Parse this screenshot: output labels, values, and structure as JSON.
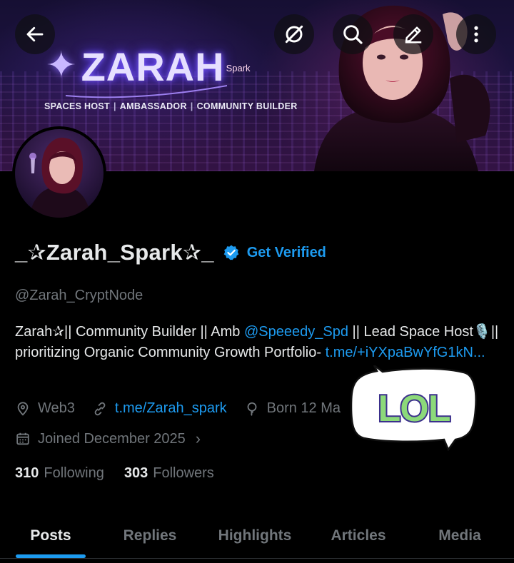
{
  "banner": {
    "brand_name": "ZARAH",
    "brand_sub": "Spark",
    "tagline": [
      "SPACES HOST",
      "AMBASSADOR",
      "COMMUNITY BUILDER"
    ]
  },
  "profile": {
    "display_name": "_✰Zarah_Spark✰_",
    "get_verified_label": "Get Verified",
    "handle": "@Zarah_CryptNode",
    "bio": {
      "part1": "Zarah✰|| Community Builder || Amb ",
      "mention": "@Speeedy_Spd",
      "part2": " ||  Lead Space Host",
      "mic": "🎙️",
      "part3": "|| prioritizing Organic Community Growth   Portfolio- ",
      "link": "t.me/​+iYXpaBwYfG1kN..."
    },
    "location": "Web3",
    "website": "t.me/Zarah_spark",
    "born": "Born 12 Ma",
    "joined": "Joined December 2025",
    "following_count": "310",
    "following_label": "Following",
    "followers_count": "303",
    "followers_label": "Followers"
  },
  "sticker": {
    "text": "LOL"
  },
  "tabs": [
    {
      "label": "Posts",
      "active": true
    },
    {
      "label": "Replies",
      "active": false
    },
    {
      "label": "Highlights",
      "active": false
    },
    {
      "label": "Articles",
      "active": false
    },
    {
      "label": "Media",
      "active": false
    }
  ],
  "colors": {
    "accent": "#1d9bf0",
    "text_primary": "#e7e9ea",
    "text_secondary": "#71767b",
    "background": "#000000"
  },
  "icons": {
    "back": "arrow-left-icon",
    "grok": "grok-icon",
    "search": "search-icon",
    "edit": "pencil-icon",
    "more": "more-vertical-icon",
    "verified": "verified-badge-icon",
    "location": "location-pin-icon",
    "link": "link-icon",
    "birthday": "birthday-icon",
    "calendar": "calendar-icon"
  }
}
